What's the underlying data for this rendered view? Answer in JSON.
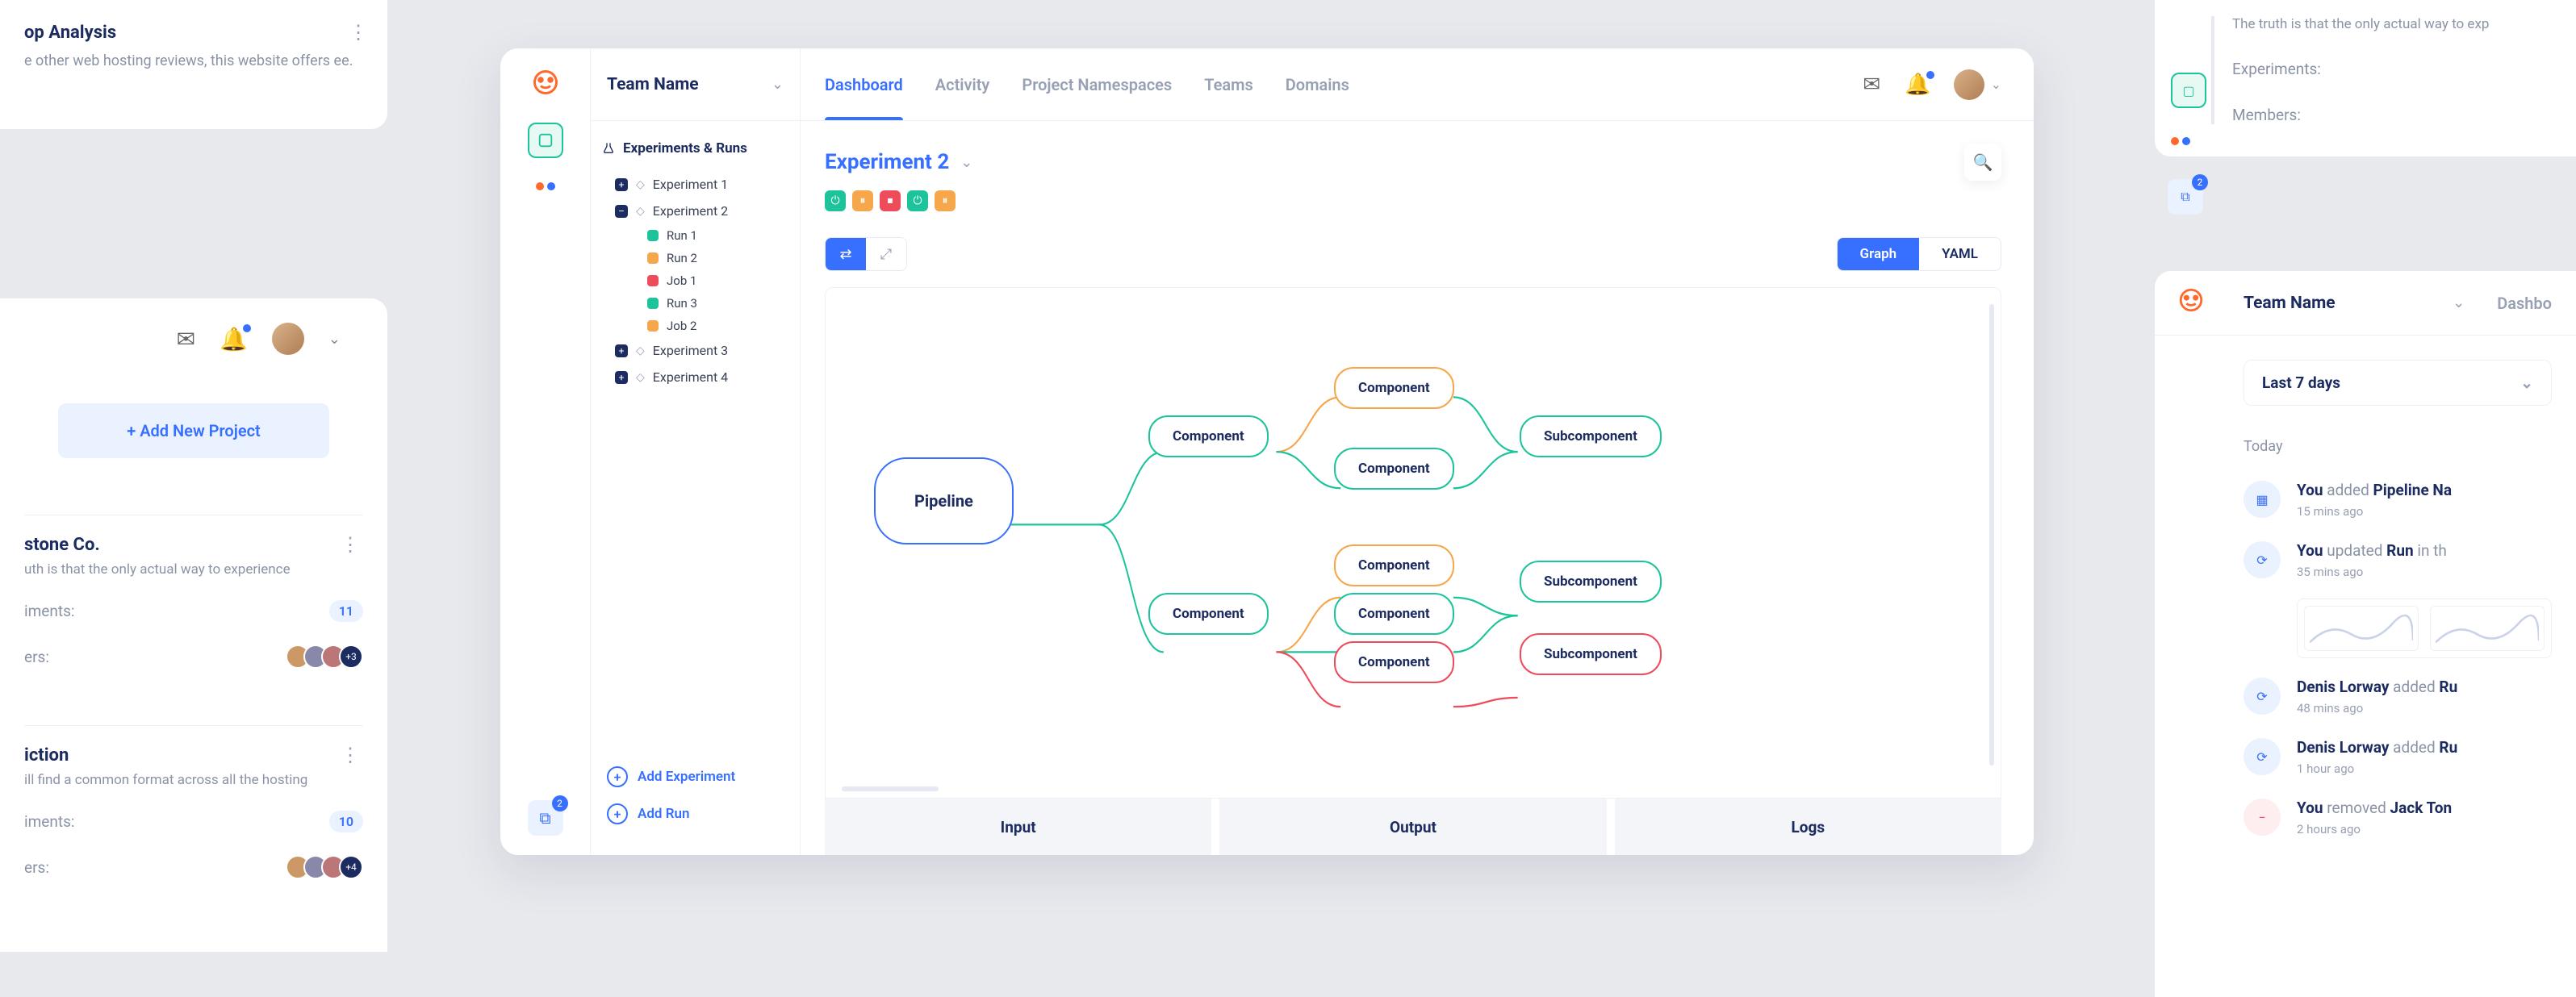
{
  "left": {
    "card_a": {
      "title": "op Analysis",
      "body": "e other web hosting reviews, this website offers ee."
    },
    "add_project": "Add New Project",
    "mini1": {
      "title": "stone Co.",
      "body": "uth is that the only actual way to experience",
      "exp_label": "iments:",
      "exp_count": "11",
      "mem_label": "ers:",
      "avatar_more": "+3"
    },
    "mini2": {
      "title": "iction",
      "body": "ill find a common format across all the hosting",
      "exp_label": "iments:",
      "exp_count": "10",
      "mem_label": "ers:",
      "avatar_more": "+4"
    }
  },
  "app": {
    "team": "Team Name",
    "nav": {
      "dashboard": "Dashboard",
      "activity": "Activity",
      "namespaces": "Project Namespaces",
      "teams": "Teams",
      "domains": "Domains"
    },
    "sidebar": {
      "group_title": "Experiments & Runs",
      "exp1": "Experiment 1",
      "exp2": "Experiment 2",
      "runs": {
        "r1": "Run 1",
        "r2": "Run 2",
        "j1": "Job 1",
        "r3": "Run 3",
        "j2": "Job 2"
      },
      "exp3": "Experiment 3",
      "exp4": "Experiment 4",
      "add_exp": "Add Experiment",
      "add_run": "Add Run"
    },
    "content": {
      "heading": "Experiment 2",
      "view_graph": "Graph",
      "view_yaml": "YAML",
      "bottom": {
        "input": "Input",
        "output": "Output",
        "logs": "Logs"
      },
      "nodes": {
        "pipeline": "Pipeline",
        "comp": "Component",
        "sub": "Subcomponent"
      }
    },
    "rail_badge": "2"
  },
  "right": {
    "quote": "The truth is that the only actual way to exp",
    "exp_label": "Experiments:",
    "mem_label": "Members:",
    "icon_badge": "2",
    "team": "Team Name",
    "dash": "Dashbo",
    "filter": "Last 7 days",
    "today": "Today",
    "items": [
      {
        "who": "You",
        "verb": "added",
        "obj": "Pipeline Na",
        "ago": "15 mins ago",
        "ic": "blue",
        "glyph": "▦"
      },
      {
        "who": "You",
        "verb": "updated",
        "obj": "Run",
        "tail": " in th",
        "ago": "35 mins ago",
        "ic": "blue",
        "glyph": "⟳",
        "spark": true
      },
      {
        "who": "Denis Lorway",
        "verb": "added",
        "obj": "Ru",
        "ago": "48 mins ago",
        "ic": "blue",
        "glyph": "⟳"
      },
      {
        "who": "Denis Lorway",
        "verb": "added",
        "obj": "Ru",
        "ago": "1 hour ago",
        "ic": "blue",
        "glyph": "⟳"
      },
      {
        "who": "You",
        "verb": "removed",
        "obj": "Jack Ton",
        "ago": "2 hours ago",
        "ic": "red",
        "glyph": "−"
      }
    ]
  }
}
